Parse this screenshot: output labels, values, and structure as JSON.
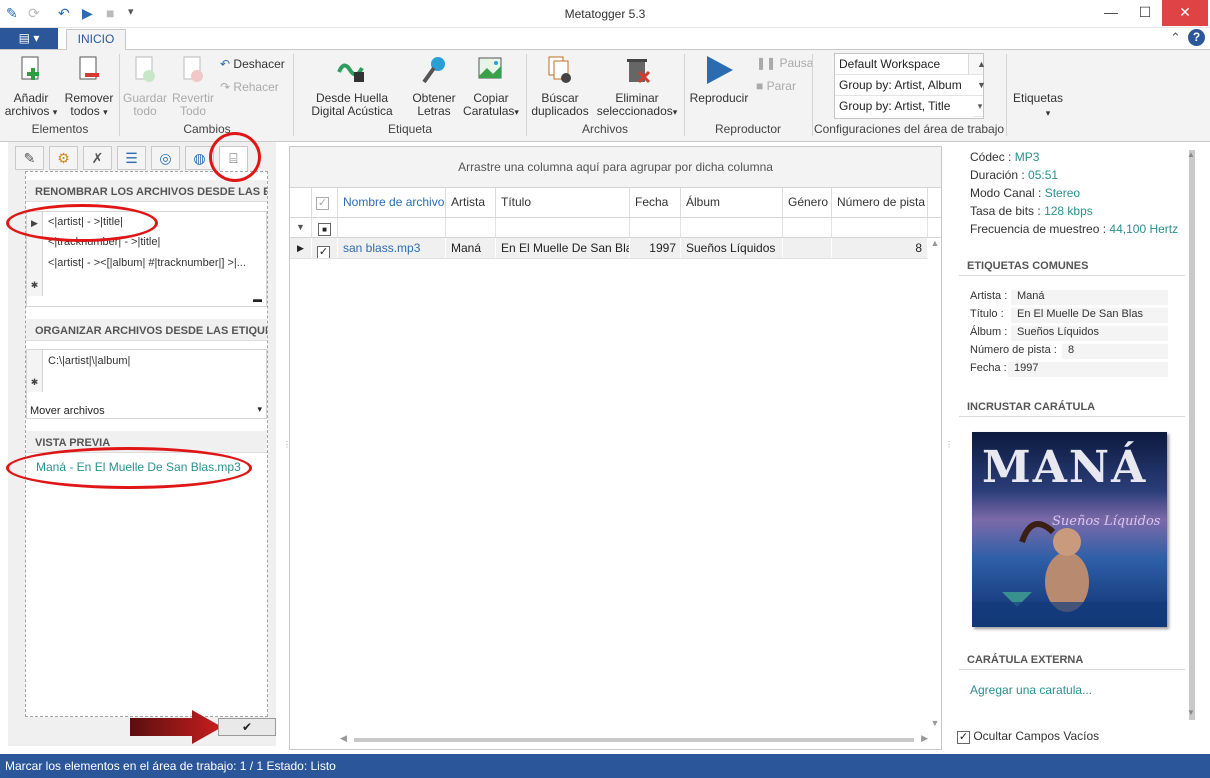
{
  "window": {
    "title": "Metatogger 5.3"
  },
  "ribbon": {
    "file_tab": "▤ ▾",
    "tab_home": "INICIO",
    "add_files": "Añadir archivos",
    "remove_all": "Remover todos",
    "save_all": "Guardar todo",
    "revert_all": "Revertir Todo",
    "undo": "Deshacer",
    "redo": "Rehacer",
    "fingerprint": "Desde Huella Digital Acústica",
    "lyrics": "Obtener Letras",
    "copy_covers": "Copiar Caratulas",
    "find_duplicates": "Búscar duplicados",
    "delete_selected": "Eliminar seleccionados",
    "play": "Reproducir",
    "pause": "Pausa",
    "stop": "Parar",
    "tags": "Etiquetas",
    "groups": {
      "elements": "Elementos",
      "changes": "Cambios",
      "tag": "Etiqueta",
      "files": "Archivos",
      "player": "Reproductor",
      "workspace": "Configuraciones del área de trabajo"
    },
    "workspaces": [
      "Default Workspace",
      "Group by: Artist, Album",
      "Group by: Artist, Title"
    ]
  },
  "left_panel": {
    "rename_header": "RENOMBRAR LOS ARCHIVOS DESDE LAS ET",
    "rename_patterns": [
      "<|artist| - >|title|",
      "<|tracknumber| - >|title|",
      "<|artist| - ><[|album| #|tracknumber|] >|..."
    ],
    "organize_header": "ORGANIZAR ARCHIVOS DESDE LAS ETIQUE",
    "organize_patterns": [
      "C:\\|artist|\\|album|"
    ],
    "move_files": "Mover archivos",
    "preview_header": "VISTA PREVIA",
    "preview_value": "Maná - En El Muelle De San Blas.mp3",
    "confirm": "✔"
  },
  "grid": {
    "group_hint": "Arrastre una columna aquí para agrupar por dicha columna",
    "columns": [
      "Nombre de archivo",
      "Artista",
      "Título",
      "Fecha",
      "Álbum",
      "Género",
      "Número de pista"
    ],
    "rows": [
      {
        "filename": "san blass.mp3",
        "artist": "Maná",
        "title": "En El Muelle De San Blas",
        "date": "1997",
        "album": "Sueños Líquidos",
        "genre": "",
        "track": "8"
      }
    ]
  },
  "right_panel": {
    "codec_label": "Códec :",
    "codec": "MP3",
    "duration_label": "Duración :",
    "duration": "05:51",
    "channel_label": "Modo Canal :",
    "channel": "Stereo",
    "bitrate_label": "Tasa de bits :",
    "bitrate": "128 kbps",
    "samplerate_label": "Frecuencia de muestreo :",
    "samplerate": "44,100 Hertz",
    "common_header": "ETIQUETAS COMUNES",
    "tags": [
      {
        "label": "Artista :",
        "value": "Maná"
      },
      {
        "label": "Título :",
        "value": "En El Muelle De San Blas"
      },
      {
        "label": "Álbum :",
        "value": "Sueños Líquidos"
      },
      {
        "label": "Número de pista :",
        "value": "8"
      },
      {
        "label": "Fecha :",
        "value": "1997"
      }
    ],
    "embed_header": "INCRUSTAR CARÁTULA",
    "cover_text": "MANÁ",
    "cover_subtext": "Sueños Líquidos",
    "external_header": "CARÁTULA EXTERNA",
    "add_cover": "Agregar una caratula...",
    "hide_empty": "Ocultar Campos Vacíos"
  },
  "status": {
    "text": "Marcar los elementos en el área de trabajo:  1 / 1    Estado:  Listo"
  },
  "colors": {
    "accent": "#2b579a",
    "link": "#2a8f8f",
    "highlight": "#e01515"
  }
}
